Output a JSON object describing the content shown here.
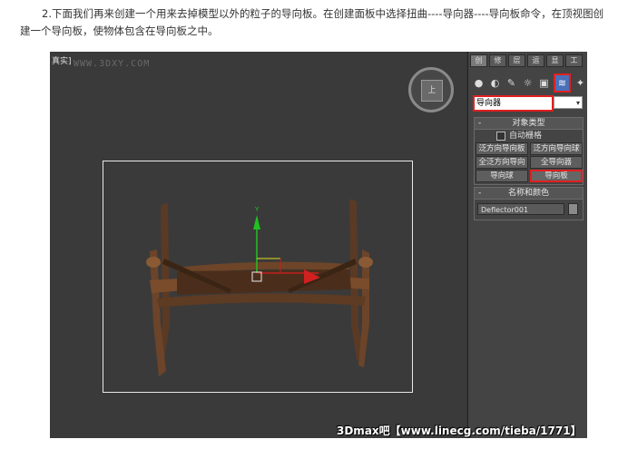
{
  "intro": {
    "text": "2.下面我们再来创建一个用来去掉模型以外的粒子的导向板。在创建面板中选择扭曲----导向器----导向板命令，在顶视图创建一个导向板，使物体包含在导向板之中。"
  },
  "viewport": {
    "label": "[+][透视][真实]",
    "label_visible": "真实]",
    "watermark_url": "WWW.3DXY.COM",
    "viewcube_face": "上"
  },
  "watermark_bottom": "3Dmax吧【www.linecg.com/tieba/1771】",
  "command_panel": {
    "tabs": [
      "创",
      "修",
      "层",
      "运",
      "显",
      "工"
    ],
    "category_icons": [
      "geometry-icon",
      "shapes-icon",
      "lights-icon",
      "cameras-icon",
      "helpers-icon",
      "spacewarps-icon",
      "systems-icon"
    ],
    "category_glyphs": [
      "●",
      "◐",
      "✎",
      "☼",
      "▣",
      "≋",
      "✦"
    ],
    "dropdown_value": "导向器",
    "dropdown_right": "▾",
    "object_type": {
      "title": "对象类型",
      "autogrid_label": "自动栅格",
      "buttons": [
        "泛方向导向板",
        "泛方向导向球",
        "全泛方向导向",
        "全导向器",
        "导向球",
        "导向板"
      ],
      "highlighted": "导向板"
    },
    "name_color": {
      "title": "名称和颜色",
      "name_value": "Deflector001",
      "color": "#8a8a8a"
    }
  },
  "colors": {
    "highlight": "#e02020",
    "viewport_bg": "#3a3a3a",
    "panel_bg": "#444444"
  }
}
